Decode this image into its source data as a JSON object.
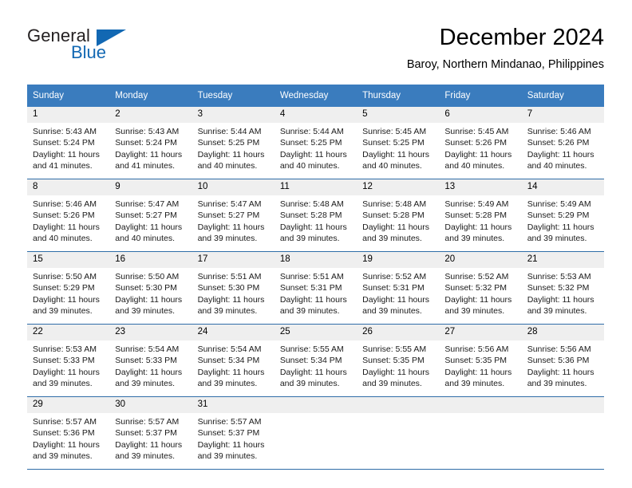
{
  "brand": {
    "name_part1": "General",
    "name_part2": "Blue",
    "flag_icon": "triangle-flag-icon",
    "accent_color": "#1268b3"
  },
  "header": {
    "title": "December 2024",
    "subtitle": "Baroy, Northern Mindanao, Philippines"
  },
  "calendar": {
    "header_bg": "#3a7cbe",
    "daynum_bg": "#efefef",
    "row_border_color": "#2f6da8",
    "weekday_headers": [
      "Sunday",
      "Monday",
      "Tuesday",
      "Wednesday",
      "Thursday",
      "Friday",
      "Saturday"
    ],
    "weeks": [
      [
        {
          "day": "1",
          "sunrise": "Sunrise: 5:43 AM",
          "sunset": "Sunset: 5:24 PM",
          "daylight_line1": "Daylight: 11 hours",
          "daylight_line2": "and 41 minutes."
        },
        {
          "day": "2",
          "sunrise": "Sunrise: 5:43 AM",
          "sunset": "Sunset: 5:24 PM",
          "daylight_line1": "Daylight: 11 hours",
          "daylight_line2": "and 41 minutes."
        },
        {
          "day": "3",
          "sunrise": "Sunrise: 5:44 AM",
          "sunset": "Sunset: 5:25 PM",
          "daylight_line1": "Daylight: 11 hours",
          "daylight_line2": "and 40 minutes."
        },
        {
          "day": "4",
          "sunrise": "Sunrise: 5:44 AM",
          "sunset": "Sunset: 5:25 PM",
          "daylight_line1": "Daylight: 11 hours",
          "daylight_line2": "and 40 minutes."
        },
        {
          "day": "5",
          "sunrise": "Sunrise: 5:45 AM",
          "sunset": "Sunset: 5:25 PM",
          "daylight_line1": "Daylight: 11 hours",
          "daylight_line2": "and 40 minutes."
        },
        {
          "day": "6",
          "sunrise": "Sunrise: 5:45 AM",
          "sunset": "Sunset: 5:26 PM",
          "daylight_line1": "Daylight: 11 hours",
          "daylight_line2": "and 40 minutes."
        },
        {
          "day": "7",
          "sunrise": "Sunrise: 5:46 AM",
          "sunset": "Sunset: 5:26 PM",
          "daylight_line1": "Daylight: 11 hours",
          "daylight_line2": "and 40 minutes."
        }
      ],
      [
        {
          "day": "8",
          "sunrise": "Sunrise: 5:46 AM",
          "sunset": "Sunset: 5:26 PM",
          "daylight_line1": "Daylight: 11 hours",
          "daylight_line2": "and 40 minutes."
        },
        {
          "day": "9",
          "sunrise": "Sunrise: 5:47 AM",
          "sunset": "Sunset: 5:27 PM",
          "daylight_line1": "Daylight: 11 hours",
          "daylight_line2": "and 40 minutes."
        },
        {
          "day": "10",
          "sunrise": "Sunrise: 5:47 AM",
          "sunset": "Sunset: 5:27 PM",
          "daylight_line1": "Daylight: 11 hours",
          "daylight_line2": "and 39 minutes."
        },
        {
          "day": "11",
          "sunrise": "Sunrise: 5:48 AM",
          "sunset": "Sunset: 5:28 PM",
          "daylight_line1": "Daylight: 11 hours",
          "daylight_line2": "and 39 minutes."
        },
        {
          "day": "12",
          "sunrise": "Sunrise: 5:48 AM",
          "sunset": "Sunset: 5:28 PM",
          "daylight_line1": "Daylight: 11 hours",
          "daylight_line2": "and 39 minutes."
        },
        {
          "day": "13",
          "sunrise": "Sunrise: 5:49 AM",
          "sunset": "Sunset: 5:28 PM",
          "daylight_line1": "Daylight: 11 hours",
          "daylight_line2": "and 39 minutes."
        },
        {
          "day": "14",
          "sunrise": "Sunrise: 5:49 AM",
          "sunset": "Sunset: 5:29 PM",
          "daylight_line1": "Daylight: 11 hours",
          "daylight_line2": "and 39 minutes."
        }
      ],
      [
        {
          "day": "15",
          "sunrise": "Sunrise: 5:50 AM",
          "sunset": "Sunset: 5:29 PM",
          "daylight_line1": "Daylight: 11 hours",
          "daylight_line2": "and 39 minutes."
        },
        {
          "day": "16",
          "sunrise": "Sunrise: 5:50 AM",
          "sunset": "Sunset: 5:30 PM",
          "daylight_line1": "Daylight: 11 hours",
          "daylight_line2": "and 39 minutes."
        },
        {
          "day": "17",
          "sunrise": "Sunrise: 5:51 AM",
          "sunset": "Sunset: 5:30 PM",
          "daylight_line1": "Daylight: 11 hours",
          "daylight_line2": "and 39 minutes."
        },
        {
          "day": "18",
          "sunrise": "Sunrise: 5:51 AM",
          "sunset": "Sunset: 5:31 PM",
          "daylight_line1": "Daylight: 11 hours",
          "daylight_line2": "and 39 minutes."
        },
        {
          "day": "19",
          "sunrise": "Sunrise: 5:52 AM",
          "sunset": "Sunset: 5:31 PM",
          "daylight_line1": "Daylight: 11 hours",
          "daylight_line2": "and 39 minutes."
        },
        {
          "day": "20",
          "sunrise": "Sunrise: 5:52 AM",
          "sunset": "Sunset: 5:32 PM",
          "daylight_line1": "Daylight: 11 hours",
          "daylight_line2": "and 39 minutes."
        },
        {
          "day": "21",
          "sunrise": "Sunrise: 5:53 AM",
          "sunset": "Sunset: 5:32 PM",
          "daylight_line1": "Daylight: 11 hours",
          "daylight_line2": "and 39 minutes."
        }
      ],
      [
        {
          "day": "22",
          "sunrise": "Sunrise: 5:53 AM",
          "sunset": "Sunset: 5:33 PM",
          "daylight_line1": "Daylight: 11 hours",
          "daylight_line2": "and 39 minutes."
        },
        {
          "day": "23",
          "sunrise": "Sunrise: 5:54 AM",
          "sunset": "Sunset: 5:33 PM",
          "daylight_line1": "Daylight: 11 hours",
          "daylight_line2": "and 39 minutes."
        },
        {
          "day": "24",
          "sunrise": "Sunrise: 5:54 AM",
          "sunset": "Sunset: 5:34 PM",
          "daylight_line1": "Daylight: 11 hours",
          "daylight_line2": "and 39 minutes."
        },
        {
          "day": "25",
          "sunrise": "Sunrise: 5:55 AM",
          "sunset": "Sunset: 5:34 PM",
          "daylight_line1": "Daylight: 11 hours",
          "daylight_line2": "and 39 minutes."
        },
        {
          "day": "26",
          "sunrise": "Sunrise: 5:55 AM",
          "sunset": "Sunset: 5:35 PM",
          "daylight_line1": "Daylight: 11 hours",
          "daylight_line2": "and 39 minutes."
        },
        {
          "day": "27",
          "sunrise": "Sunrise: 5:56 AM",
          "sunset": "Sunset: 5:35 PM",
          "daylight_line1": "Daylight: 11 hours",
          "daylight_line2": "and 39 minutes."
        },
        {
          "day": "28",
          "sunrise": "Sunrise: 5:56 AM",
          "sunset": "Sunset: 5:36 PM",
          "daylight_line1": "Daylight: 11 hours",
          "daylight_line2": "and 39 minutes."
        }
      ],
      [
        {
          "day": "29",
          "sunrise": "Sunrise: 5:57 AM",
          "sunset": "Sunset: 5:36 PM",
          "daylight_line1": "Daylight: 11 hours",
          "daylight_line2": "and 39 minutes."
        },
        {
          "day": "30",
          "sunrise": "Sunrise: 5:57 AM",
          "sunset": "Sunset: 5:37 PM",
          "daylight_line1": "Daylight: 11 hours",
          "daylight_line2": "and 39 minutes."
        },
        {
          "day": "31",
          "sunrise": "Sunrise: 5:57 AM",
          "sunset": "Sunset: 5:37 PM",
          "daylight_line1": "Daylight: 11 hours",
          "daylight_line2": "and 39 minutes."
        },
        {
          "day": "",
          "sunrise": "",
          "sunset": "",
          "daylight_line1": "",
          "daylight_line2": ""
        },
        {
          "day": "",
          "sunrise": "",
          "sunset": "",
          "daylight_line1": "",
          "daylight_line2": ""
        },
        {
          "day": "",
          "sunrise": "",
          "sunset": "",
          "daylight_line1": "",
          "daylight_line2": ""
        },
        {
          "day": "",
          "sunrise": "",
          "sunset": "",
          "daylight_line1": "",
          "daylight_line2": ""
        }
      ]
    ]
  }
}
